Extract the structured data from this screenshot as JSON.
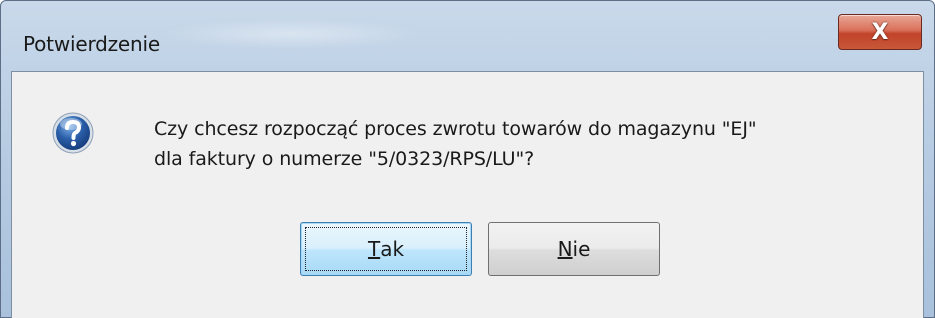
{
  "window": {
    "title": "Potwierdzenie",
    "close_glyph": "X"
  },
  "dialog": {
    "icon": "question-icon",
    "message_line1": "Czy chcesz rozpocząć proces zwrotu towarów do magazynu \"EJ\"",
    "message_line2": "dla faktury o numerze \"5/0323/RPS/LU\"?"
  },
  "buttons": {
    "yes": {
      "mnemonic": "T",
      "rest": "ak"
    },
    "no": {
      "mnemonic": "N",
      "rest": "ie"
    }
  },
  "colors": {
    "close_button": "#c75838",
    "icon_blue": "#2a5ea8",
    "client_background": "#f0f0f0",
    "default_button_border": "#3c7fb1"
  }
}
